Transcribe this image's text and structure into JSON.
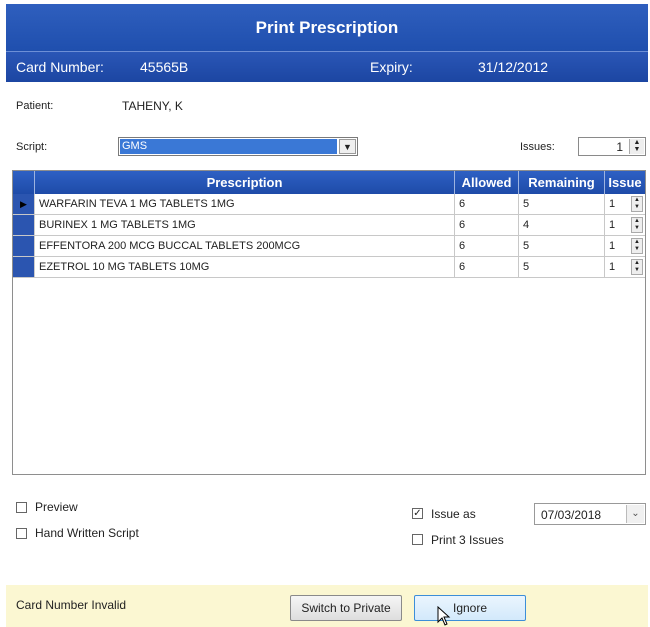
{
  "window": {
    "title": "Print Prescription"
  },
  "card": {
    "number_label": "Card Number:",
    "number_value": "45565B",
    "expiry_label": "Expiry:",
    "expiry_value": "31/12/2012"
  },
  "patient": {
    "label": "Patient:",
    "value": "TAHENY, K"
  },
  "script": {
    "label": "Script:",
    "selected": "GMS"
  },
  "issues": {
    "label": "Issues:",
    "value": "1"
  },
  "grid": {
    "columns": [
      "Prescription",
      "Allowed",
      "Remaining",
      "Issue"
    ],
    "rows": [
      {
        "prescription": "WARFARIN TEVA 1 MG TABLETS 1MG",
        "allowed": "6",
        "remaining": "5",
        "issue": "1"
      },
      {
        "prescription": "BURINEX 1 MG TABLETS 1MG",
        "allowed": "6",
        "remaining": "4",
        "issue": "1"
      },
      {
        "prescription": "EFFENTORA 200 MCG BUCCAL TABLETS 200MCG",
        "allowed": "6",
        "remaining": "5",
        "issue": "1"
      },
      {
        "prescription": "EZETROL 10 MG TABLETS 10MG",
        "allowed": "6",
        "remaining": "5",
        "issue": "1"
      }
    ]
  },
  "options": {
    "preview": "Preview",
    "hand_written": "Hand Written Script",
    "issue_as": "Issue as",
    "print_3_issues": "Print 3 Issues",
    "issue_date": "07/03/2018"
  },
  "status": {
    "message": "Card Number Invalid"
  },
  "buttons": {
    "switch_private": "Switch to Private",
    "ignore": "Ignore"
  },
  "colors": {
    "header_blue": "#2f5fbe",
    "status_yellow": "#fbf7d2",
    "selection_blue": "#3a78d6"
  }
}
